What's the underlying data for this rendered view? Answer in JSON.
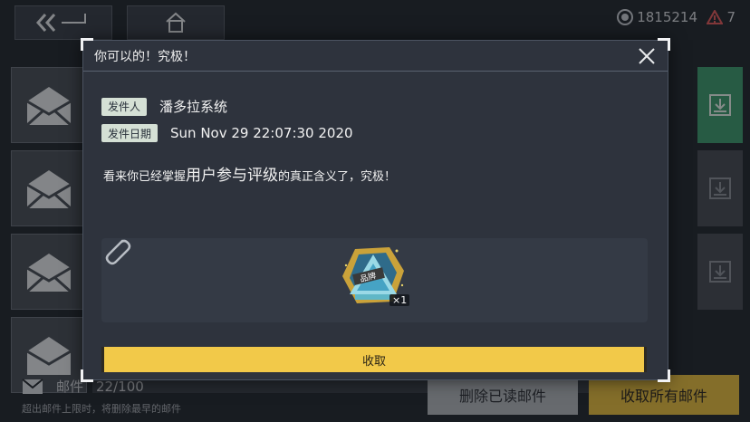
{
  "topbar": {
    "back_icon": "double-chevron-left-icon",
    "home_icon": "home-icon",
    "currency_value": "1815214",
    "alert_count": "7"
  },
  "mail_list": {
    "rows": [
      {
        "has_reward": true,
        "action": "collect",
        "action_color": "#3f9c6e"
      },
      {
        "has_reward": true,
        "action": "collect",
        "action_color": "#474c53"
      },
      {
        "has_reward": true,
        "action": "collect",
        "action_color": "#474c53"
      },
      {
        "has_reward": true,
        "action": "none",
        "action_color": "#474c53"
      }
    ]
  },
  "bottom": {
    "mail_label": "邮件",
    "mail_count": "22/100",
    "note": "超出邮件上限时，将删除最早的邮件",
    "delete_read_label": "删除已读邮件",
    "collect_all_label": "收取所有邮件"
  },
  "dialog": {
    "title": "你可以的！究极！",
    "sender_label": "发件人",
    "sender_value": "潘多拉系统",
    "date_label": "发件日期",
    "date_value": "Sun Nov 29 22:07:30 2020",
    "body_prefix": "看来你已经掌握",
    "body_emphasis": "用户参与评级",
    "body_suffix": "的真正含义了，究极！",
    "attachment": {
      "item_name": "品牌",
      "quantity": "×1"
    },
    "collect_label": "收取"
  },
  "colors": {
    "accent_yellow": "#f2c949",
    "accent_green": "#3f9c6e",
    "label_bg": "#d5e0d5"
  }
}
